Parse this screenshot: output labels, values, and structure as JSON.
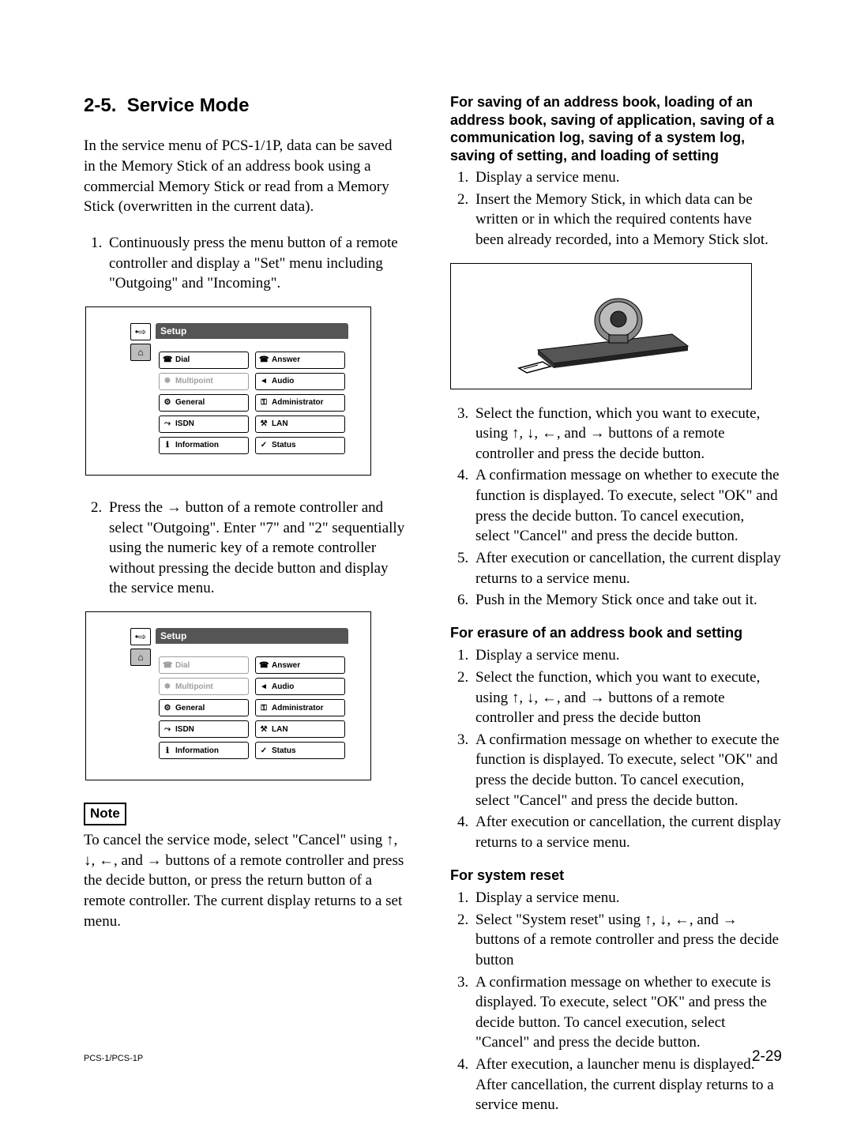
{
  "section": {
    "number": "2-5.",
    "title": "Service Mode"
  },
  "left": {
    "intro": "In the service menu of PCS-1/1P, data can be saved in the Memory Stick of an address book using a commercial Memory Stick or read from a Memory Stick (overwritten in the current data).",
    "step1": "Continuously press the menu button of a remote controller and display a \"Set\" menu including \"Outgoing\" and \"Incoming\".",
    "step2": "Press the → button of a remote controller and select \"Outgoing\".  Enter \"7\" and \"2\" sequentially using the numeric key of a remote controller without pressing the decide button and display the service menu.",
    "note_label": "Note",
    "note_text": "To cancel the service mode, select \"Cancel\" using ↑, ↓, ←, and → buttons of a remote controller and press the decide button, or press the return button of a remote controller. The current display returns to a set menu."
  },
  "setup_menu": {
    "title": "Setup",
    "items_left": [
      {
        "icon": "☎",
        "label": "Dial"
      },
      {
        "icon": "❅",
        "label": "Multipoint"
      },
      {
        "icon": "⚙",
        "label": "General"
      },
      {
        "icon": "⤳",
        "label": "ISDN"
      },
      {
        "icon": "ℹ",
        "label": "Information"
      }
    ],
    "items_right": [
      {
        "icon": "☎",
        "label": "Answer"
      },
      {
        "icon": "◄",
        "label": "Audio"
      },
      {
        "icon": "⚿",
        "label": "Administrator"
      },
      {
        "icon": "⚒",
        "label": "LAN"
      },
      {
        "icon": "✓",
        "label": "Status"
      }
    ],
    "side_top": "•⇨",
    "side_bottom": "⌂"
  },
  "right": {
    "h_saving": "For saving of an address book, loading of an address book, saving of application, saving of a communication log, saving of a system log, saving of setting, and loading of setting",
    "saving_steps_pre": [
      "Display a service menu.",
      "Insert the Memory Stick, in which data can be written or in which the required contents have been already recorded, into a Memory Stick slot."
    ],
    "saving_steps_post": [
      "Select the function, which you want to execute, using ↑, ↓, ←, and → buttons of a remote controller and press the decide button.",
      "A confirmation message on whether to execute the function is displayed.  To execute, select \"OK\" and press the decide button.  To cancel execution, select \"Cancel\" and press the decide button.",
      "After execution or cancellation, the current display returns to a service menu.",
      "Push in the Memory Stick once and take out it."
    ],
    "h_erasure": "For erasure of an address book and setting",
    "erasure_steps": [
      "Display a service menu.",
      "Select the function, which you want to execute, using ↑, ↓, ←, and → buttons of a remote controller and press the decide button",
      "A confirmation message on whether to execute the function is displayed.  To execute, select \"OK\" and press the decide button.  To cancel execution, select \"Cancel\" and press the decide button.",
      "After execution or cancellation, the current display returns to a service menu."
    ],
    "h_reset": "For system reset",
    "reset_steps": [
      "Display a service menu.",
      "Select \"System reset\" using ↑, ↓, ←, and → buttons of a remote controller and press the decide button",
      "A confirmation message on whether to execute is displayed.  To execute, select \"OK\" and press the decide button.  To cancel execution, select \"Cancel\" and press the decide button.",
      "After execution, a launcher menu is displayed.  After cancellation, the current display returns to a service menu."
    ]
  },
  "footer": {
    "left": "PCS-1/PCS-1P",
    "right": "2-29"
  }
}
